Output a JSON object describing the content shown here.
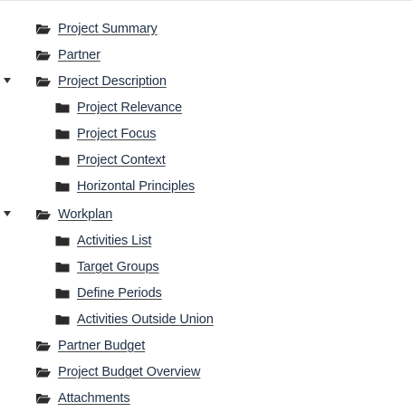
{
  "tree": {
    "items": [
      {
        "label": "Project Summary",
        "icon": "folder-open-icon",
        "expanded": false,
        "level": 0
      },
      {
        "label": "Partner",
        "icon": "folder-open-icon",
        "expanded": false,
        "level": 0
      },
      {
        "label": "Project Description",
        "icon": "folder-open-icon",
        "expanded": true,
        "level": 0
      },
      {
        "label": "Project Relevance",
        "icon": "folder-icon",
        "level": 1
      },
      {
        "label": "Project Focus",
        "icon": "folder-icon",
        "level": 1
      },
      {
        "label": "Project Context",
        "icon": "folder-icon",
        "level": 1
      },
      {
        "label": "Horizontal Principles",
        "icon": "folder-icon",
        "level": 1
      },
      {
        "label": "Workplan",
        "icon": "folder-open-icon",
        "expanded": true,
        "level": 0
      },
      {
        "label": "Activities List",
        "icon": "folder-icon",
        "level": 1
      },
      {
        "label": "Target Groups",
        "icon": "folder-icon",
        "level": 1
      },
      {
        "label": "Define Periods",
        "icon": "folder-icon",
        "level": 1
      },
      {
        "label": "Activities Outside Union",
        "icon": "folder-icon",
        "level": 1
      },
      {
        "label": "Partner Budget",
        "icon": "folder-open-icon",
        "expanded": false,
        "level": 0
      },
      {
        "label": "Project Budget Overview",
        "icon": "folder-open-icon",
        "expanded": false,
        "level": 0
      },
      {
        "label": "Attachments",
        "icon": "folder-open-icon",
        "expanded": false,
        "level": 0
      }
    ]
  },
  "colors": {
    "link_text": "#1f2f45",
    "icon": "#2b2b2b",
    "caret": "#333333",
    "background": "#ffffff"
  }
}
